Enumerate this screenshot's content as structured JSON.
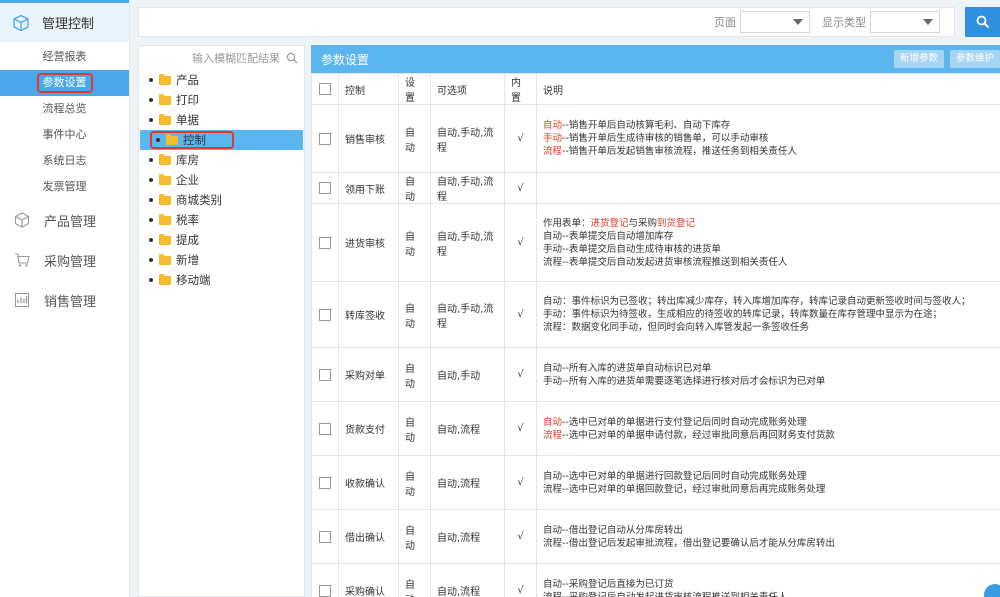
{
  "nav": {
    "top_label": "管理控制",
    "sub_items": [
      {
        "label": "经营报表"
      },
      {
        "label": "参数设置",
        "active": true
      },
      {
        "label": "流程总览"
      },
      {
        "label": "事件中心"
      },
      {
        "label": "系统日志"
      },
      {
        "label": "发票管理"
      }
    ],
    "modules": [
      {
        "label": "产品管理",
        "icon": "box-icon"
      },
      {
        "label": "采购管理",
        "icon": "cart-icon"
      },
      {
        "label": "销售管理",
        "icon": "sales-icon"
      }
    ]
  },
  "topbar": {
    "page_label": "页面",
    "page_value": "",
    "type_label": "显示类型",
    "type_value": ""
  },
  "tree": {
    "search_placeholder": "输入模糊匹配结果",
    "nodes": [
      "产品",
      "打印",
      "单据",
      "控制",
      "库房",
      "企业",
      "商城类别",
      "税率",
      "提成",
      "新增",
      "移动端"
    ],
    "active_index": 3
  },
  "panel": {
    "title": "参数设置",
    "add_label": "新增参数",
    "maint_label": "参数维护",
    "headers": {
      "control": "控制",
      "setting": "设置",
      "options": "可选项",
      "builtin": "内置",
      "desc": "说明"
    },
    "rows": [
      {
        "control": "销售审核",
        "setting": "自动",
        "options": "自动,手动,流程",
        "builtin": "√",
        "desc": [
          [
            {
              "t": "自动",
              "red": true
            },
            {
              "t": "--销售开单后自动核算毛利、自动下库存"
            }
          ],
          [
            {
              "t": "手动",
              "red": true
            },
            {
              "t": "--销售开单后生成待审核的销售单，可以手动审核"
            }
          ],
          [
            {
              "t": "流程",
              "red": true
            },
            {
              "t": "--销售开单后发起销售审核流程，推送任务到相关责任人"
            }
          ]
        ]
      },
      {
        "control": "领用下账",
        "setting": "自动",
        "options": "自动,手动,流程",
        "builtin": "√",
        "desc": []
      },
      {
        "control": "进货审核",
        "setting": "自动",
        "options": "自动,手动,流程",
        "builtin": "√",
        "desc": [
          [
            {
              "t": "作用表单："
            },
            {
              "t": "进货登记",
              "red": true
            },
            {
              "t": "与采购"
            },
            {
              "t": "到货登记",
              "red": true
            }
          ],
          [
            {
              "t": "自动--表单提交后自动增加库存"
            }
          ],
          [
            {
              "t": "手动--表单提交后自动生成待审核的进货单"
            }
          ],
          [
            {
              "t": "流程--表单提交后自动发起进货审核流程推送到相关责任人"
            }
          ]
        ]
      },
      {
        "control": "转库签收",
        "setting": "自动",
        "options": "自动,手动,流程",
        "builtin": "√",
        "desc": [
          [
            {
              "t": "自动：事件标识为已签收；转出库减少库存，转入库增加库存，转库记录自动更新签收时间与签收人；"
            }
          ],
          [
            {
              "t": "手动：事件标识为待签收，生成相应的待签收的转库记录，转库数量在库存管理中显示为在途；"
            }
          ],
          [
            {
              "t": "流程：数据变化同手动，但同时会向转入库管发起一条签收任务"
            }
          ]
        ]
      },
      {
        "control": "采购对单",
        "setting": "自动",
        "options": "自动,手动",
        "builtin": "√",
        "desc": [
          [
            {
              "t": "自动--所有入库的进货单自动标识已对单"
            }
          ],
          [
            {
              "t": "手动--所有入库的进货单需要逐笔选择进行核对后才会标识为已对单"
            }
          ]
        ]
      },
      {
        "control": "货款支付",
        "setting": "自动",
        "options": "自动,流程",
        "builtin": "√",
        "desc": [
          [
            {
              "t": "自动",
              "red": true
            },
            {
              "t": "--选中已对单的单据进行支付登记后同时自动完成账务处理"
            }
          ],
          [
            {
              "t": "流程",
              "red": true
            },
            {
              "t": "--选中已对单的单据申请付款，经过审批同意后再回财务支付货款"
            }
          ]
        ]
      },
      {
        "control": "收款确认",
        "setting": "自动",
        "options": "自动,流程",
        "builtin": "√",
        "desc": [
          [
            {
              "t": "自动--选中已对单的单据进行回款登记后同时自动完成账务处理"
            }
          ],
          [
            {
              "t": "流程--选中已对单的单据回款登记，经过审批同意后再完成账务处理"
            }
          ]
        ]
      },
      {
        "control": "借出确认",
        "setting": "自动",
        "options": "自动,流程",
        "builtin": "√",
        "desc": [
          [
            {
              "t": "自动--借出登记自动从分库房转出"
            }
          ],
          [
            {
              "t": "流程--借出登记后发起审批流程，借出登记要确认后才能从分库房转出"
            }
          ]
        ]
      },
      {
        "control": "采购确认",
        "setting": "自动",
        "options": "自动,流程",
        "builtin": "√",
        "desc": [
          [
            {
              "t": "自动--采购登记后直接为已订货"
            }
          ],
          [
            {
              "t": "流程--采购登记后自动发起进货审核流程推送到相关责任人"
            }
          ]
        ]
      }
    ]
  }
}
